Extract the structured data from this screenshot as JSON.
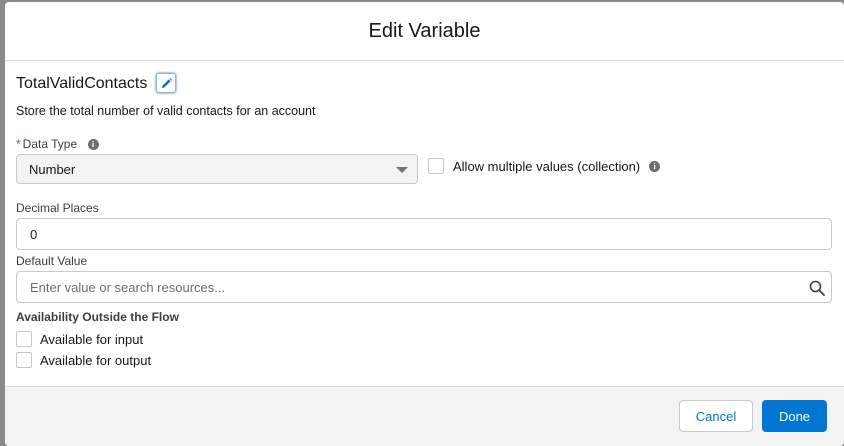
{
  "modal": {
    "title": "Edit Variable",
    "variable_name": "TotalValidContacts",
    "description": "Store the total number of valid contacts for an account"
  },
  "data_type": {
    "required_marker": "*",
    "label": "Data Type",
    "value": "Number"
  },
  "collection": {
    "label": "Allow multiple values (collection)",
    "checked": false
  },
  "decimal_places": {
    "label": "Decimal Places",
    "value": "0"
  },
  "default_value": {
    "label": "Default Value",
    "placeholder": "Enter value or search resources..."
  },
  "availability": {
    "heading": "Availability Outside the Flow",
    "input_label": "Available for input",
    "output_label": "Available for output"
  },
  "footer": {
    "cancel_label": "Cancel",
    "done_label": "Done"
  },
  "colors": {
    "brand": "#0176d3",
    "required": "#c23934"
  }
}
